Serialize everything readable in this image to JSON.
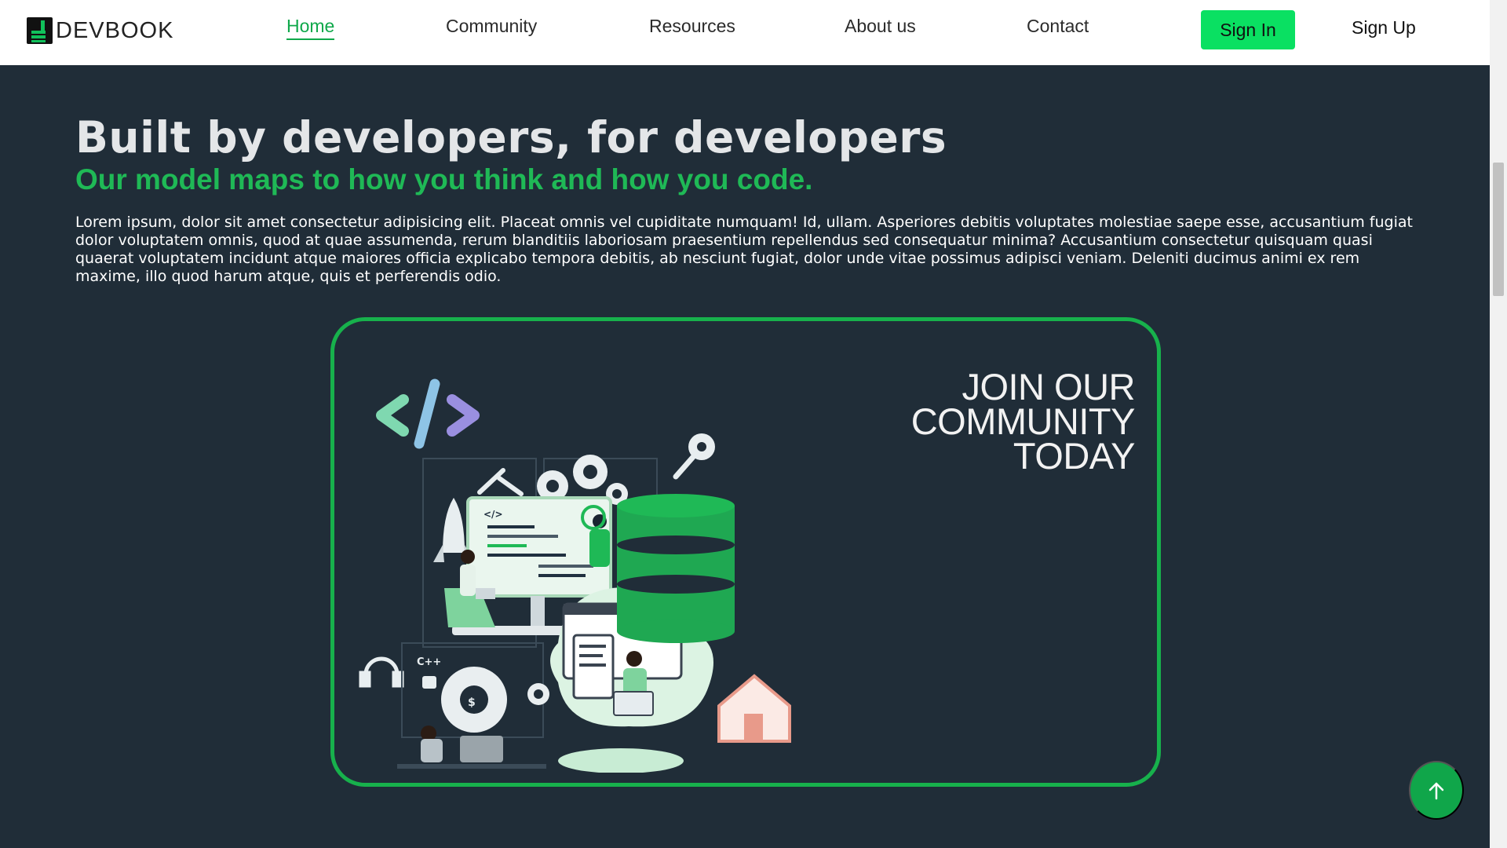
{
  "brand": {
    "name": "DEVBOOK",
    "accent": "#0ae062",
    "green": "#17b14c",
    "background": "#202d38"
  },
  "nav": {
    "links": [
      {
        "label": "Home",
        "active": true
      },
      {
        "label": "Community",
        "active": false
      },
      {
        "label": "Resources",
        "active": false
      },
      {
        "label": "About us",
        "active": false
      },
      {
        "label": "Contact",
        "active": false
      }
    ],
    "sign_in": "Sign In",
    "sign_up": "Sign Up"
  },
  "hero": {
    "title": "Built by developers, for developers",
    "subtitle": "Our model maps to how you think and how you code.",
    "body": "Lorem ipsum, dolor sit amet consectetur adipisicing elit. Placeat omnis vel cupiditate numquam! Id, ullam. Asperiores debitis voluptates molestiae saepe esse, accusantium fugiat dolor voluptatem omnis, quod at quae assumenda, rerum blanditiis laboriosam praesentium repellendus sed consequatur minima? Accusantium consectetur quisquam quasi quaerat voluptatem incidunt atque maiores officia explicabo tempora debitis, ab nesciunt fugiat, dolor unde vitae possimus adipisci veniam. Deleniti ducimus animi ex rem maxime, illo quod harum atque, quis et perferendis odio."
  },
  "community_card": {
    "lines": [
      "JOIN OUR",
      "COMMUNITY",
      "TODAY"
    ],
    "art_labels": {
      "code_tag": "</>",
      "cpp": "C++",
      "dollar": "$"
    }
  },
  "icons": {
    "back_to_top": "arrow-up-icon",
    "code": "code-brackets-icon",
    "key": "key-icon",
    "database": "database-icon",
    "house": "house-icon",
    "gear": "gear-icon",
    "headset": "headset-icon",
    "rocket": "rocket-icon"
  }
}
